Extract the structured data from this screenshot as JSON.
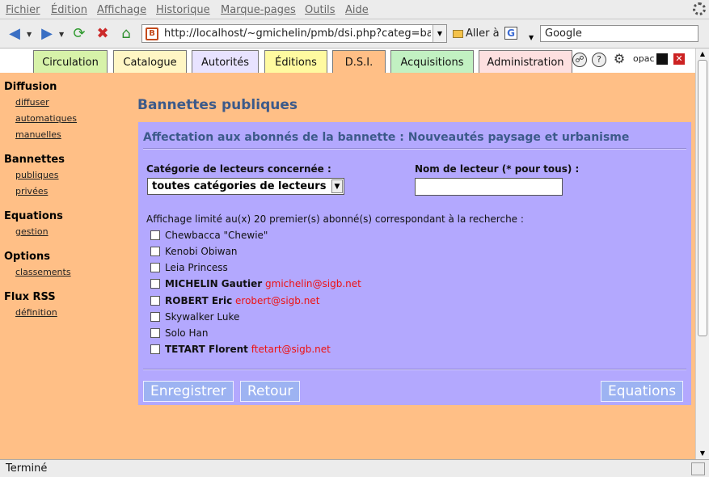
{
  "browser": {
    "menu": [
      "Fichier",
      "Édition",
      "Affichage",
      "Historique",
      "Marque-pages",
      "Outils",
      "Aide"
    ],
    "url": "http://localhost/~gmichelin/pmb/dsi.php?categ=bannettes",
    "go_label": "Aller à",
    "search_engine_letter": "G",
    "search_value": "Google",
    "status": "Terminé"
  },
  "tabs": [
    {
      "label": "Circulation",
      "color": "#d7f2a9"
    },
    {
      "label": "Catalogue",
      "color": "#fff6c4"
    },
    {
      "label": "Autorités",
      "color": "#e8e3ff"
    },
    {
      "label": "Éditions",
      "color": "#fffaa0"
    },
    {
      "label": "D.S.I.",
      "color": "#ffbf86"
    },
    {
      "label": "Acquisitions",
      "color": "#c2f1c2"
    },
    {
      "label": "Administration",
      "color": "#fde0e0"
    }
  ],
  "tools": {
    "opac_label": "opac"
  },
  "sidebar": [
    {
      "title": "Diffusion",
      "links": [
        "diffuser",
        "automatiques",
        "manuelles"
      ]
    },
    {
      "title": "Bannettes",
      "links": [
        "publiques",
        "privées"
      ]
    },
    {
      "title": "Equations",
      "links": [
        "gestion"
      ]
    },
    {
      "title": "Options",
      "links": [
        "classements"
      ]
    },
    {
      "title": "Flux RSS",
      "links": [
        "définition"
      ]
    }
  ],
  "main": {
    "page_title": "Bannettes publiques",
    "panel_title": "Affectation aux abonnés de la bannette : Nouveautés paysage et urbanisme",
    "category_label": "Catégorie de lecteurs concernée :",
    "category_value": "toutes catégories de lecteurs",
    "reader_label": "Nom de lecteur (* pour tous) :",
    "reader_value": "",
    "info": "Affichage limité au(x) 20 premier(s) abonné(s) correspondant à la recherche :",
    "subscribers": [
      {
        "name": "Chewbacca \"Chewie\"",
        "bold": false,
        "email": ""
      },
      {
        "name": "Kenobi Obiwan",
        "bold": false,
        "email": ""
      },
      {
        "name": "Leia Princess",
        "bold": false,
        "email": ""
      },
      {
        "name": "MICHELIN Gautier",
        "bold": true,
        "email": "gmichelin@sigb.net"
      },
      {
        "name": "ROBERT Eric",
        "bold": true,
        "email": "erobert@sigb.net"
      },
      {
        "name": "Skywalker Luke",
        "bold": false,
        "email": ""
      },
      {
        "name": "Solo Han",
        "bold": false,
        "email": ""
      },
      {
        "name": "TETART Florent",
        "bold": true,
        "email": "ftetart@sigb.net"
      }
    ],
    "buttons": {
      "save": "Enregistrer",
      "back": "Retour",
      "equations": "Equations"
    }
  }
}
